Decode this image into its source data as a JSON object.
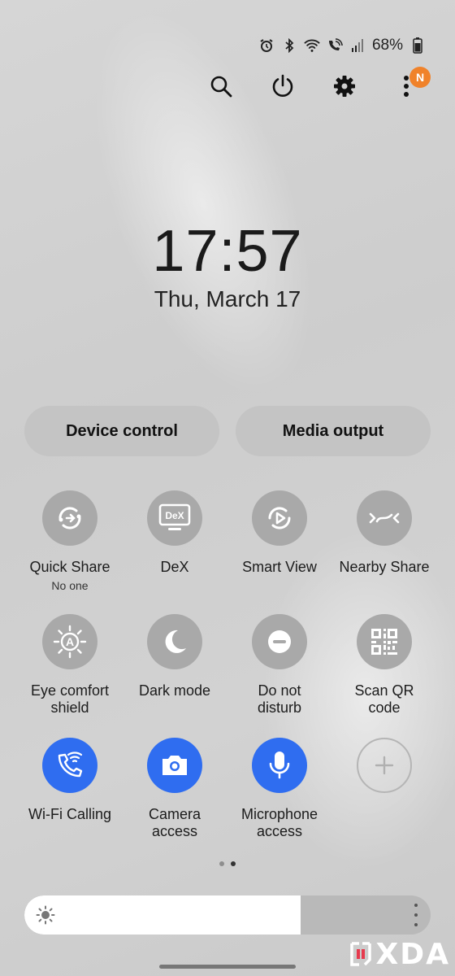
{
  "status": {
    "battery_percent": "68%",
    "icons": [
      "alarm-icon",
      "bluetooth-icon",
      "wifi-icon",
      "wifi-calling-icon",
      "signal-icon",
      "battery-icon"
    ]
  },
  "toolbar": {
    "icons": [
      "search-icon",
      "power-icon",
      "gear-icon",
      "more-vert-icon"
    ],
    "notification_badge": "N"
  },
  "clock": {
    "time": "17:57",
    "date": "Thu, March 17"
  },
  "buttons": {
    "device_control": "Device control",
    "media_output": "Media output"
  },
  "tiles": [
    {
      "label": "Quick Share",
      "sub": "No one",
      "icon": "quick-share-icon",
      "active": false
    },
    {
      "label": "DeX",
      "icon": "dex-icon",
      "active": false
    },
    {
      "label": "Smart View",
      "icon": "smart-view-icon",
      "active": false
    },
    {
      "label": "Nearby Share",
      "icon": "nearby-share-icon",
      "active": false
    },
    {
      "label": "Eye comfort\nshield",
      "icon": "eye-comfort-icon",
      "active": false
    },
    {
      "label": "Dark mode",
      "icon": "moon-icon",
      "active": false
    },
    {
      "label": "Do not\ndisturb",
      "icon": "dnd-icon",
      "active": false
    },
    {
      "label": "Scan QR\ncode",
      "icon": "qr-code-icon",
      "active": false
    },
    {
      "label": "Wi-Fi Calling",
      "icon": "wifi-calling-icon",
      "active": true
    },
    {
      "label": "Camera\naccess",
      "icon": "camera-icon",
      "active": true
    },
    {
      "label": "Microphone\naccess",
      "icon": "microphone-icon",
      "active": true
    },
    {
      "label": "",
      "icon": "add-icon",
      "active": false
    }
  ],
  "pager": {
    "pages": 2,
    "current": 2
  },
  "brightness": {
    "level": 0.68
  },
  "watermark": {
    "text": "XDA"
  },
  "colors": {
    "active_tile": "#2f6df0",
    "badge": "#f0822a"
  }
}
